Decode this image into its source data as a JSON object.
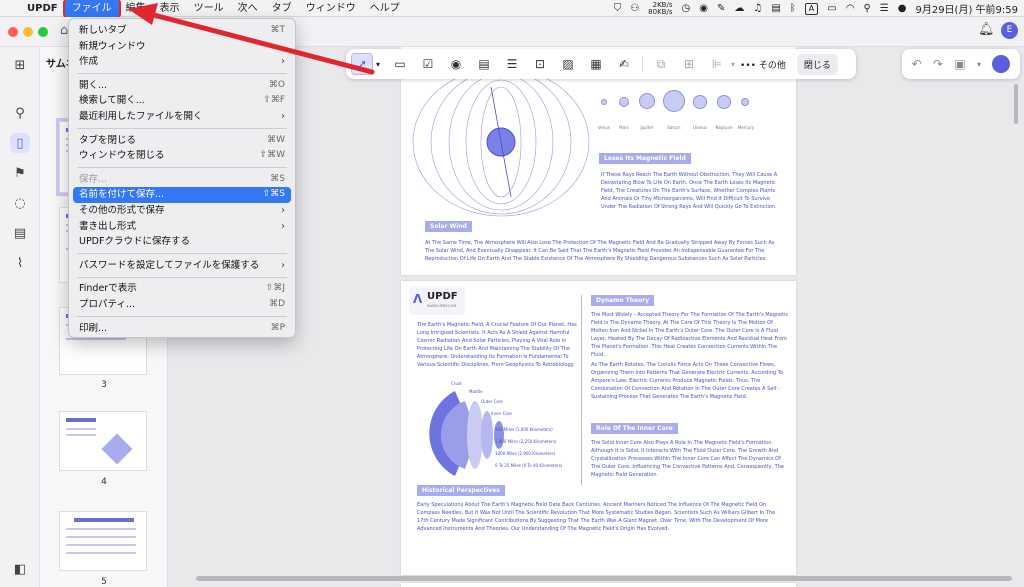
{
  "menubar": {
    "apple": "",
    "app": "UPDF",
    "items": [
      "ファイル",
      "編集",
      "表示",
      "ツール",
      "次へ",
      "タブ",
      "ウィンドウ",
      "ヘルプ"
    ],
    "net_up": "2KB/s",
    "net_down": "80KB/s",
    "input_mode": "A",
    "datetime": "9月29日(月) 午前9:59"
  },
  "thumbs": {
    "header": "サムネ",
    "pages": [
      "3",
      "4",
      "5"
    ]
  },
  "file_menu": {
    "items": [
      {
        "label": "新しいタブ",
        "shortcut": "⌘T"
      },
      {
        "label": "新規ウィンドウ",
        "shortcut": ""
      },
      {
        "label": "作成",
        "submenu": "›"
      },
      {
        "label": "開く...",
        "shortcut": "⌘O"
      },
      {
        "label": "検索して開く...",
        "shortcut": "⇧⌘F"
      },
      {
        "label": "最近利用したファイルを開く",
        "submenu": "›"
      },
      {
        "label": "タブを閉じる",
        "shortcut": "⌘W"
      },
      {
        "label": "ウィンドウを閉じる",
        "shortcut": "⇧⌘W"
      },
      {
        "label": "保存...",
        "shortcut": "⌘S"
      },
      {
        "label": "名前を付けて保存...",
        "shortcut": "⇧⌘S"
      },
      {
        "label": "その他の形式で保存",
        "submenu": "›"
      },
      {
        "label": "書き出し形式",
        "submenu": "›"
      },
      {
        "label": "UPDFクラウドに保存する",
        "shortcut": ""
      },
      {
        "label": "パスワードを設定してファイルを保護する",
        "submenu": "›"
      },
      {
        "label": "Finderで表示",
        "shortcut": "⇧⌘J"
      },
      {
        "label": "プロパティ...",
        "shortcut": "⌘D"
      },
      {
        "label": "印刷...",
        "shortcut": "⌘P"
      }
    ]
  },
  "toolbar": {
    "more_label": "その他",
    "close_label": "閉じる"
  },
  "document": {
    "page1": {
      "section_title_1": "Loses Its Magnetic Field",
      "section_text_1": "If These Rays Reach The Earth Without Obstruction, They Will Cause A Devastating Blow To Life On Earth. Once The Earth Loses Its Magnetic Field, The Creatures On The Earth's Surface, Whether Complex Plants And Animals Or Tiny Microorganisms, Will Find It Difficult To Survive Under The Radiation Of Strong Rays And Will Quickly Go To Extinction.",
      "section_title_2": "Solar Wind",
      "section_text_2": "At The Same Time, The Atmosphere Will Also Lose The Protection Of The Magnetic Field And Be Gradually Stripped Away By Forces Such As The Solar Wind, And Eventually Disappear. It Can Be Said That The Earth's Magnetic Field Provides An Indispensable Guarantee For The Reproduction Of Life On Earth And The Stable Existence Of The Atmosphere By Shielding Dangerous Substances Such As Solar Particles.",
      "planet_labels": [
        "Venus",
        "Mars",
        "Jupiter",
        "Saturn",
        "Uranus",
        "Neptune",
        "Mercury"
      ]
    },
    "page2": {
      "logo_text": "UPDF",
      "logo_sub": "WWW.UPDF.COM",
      "intro_text": "The Earth's Magnetic Field, A Crucial Feature Of Our Planet, Has Long Intrigued Scientists. It Acts As A Shield Against Harmful Cosmic Radiation And Solar Particles, Playing A Vital Role In Protecting Life On Earth And Maintaining The Stability Of The Atmosphere. Understanding Its Formation Is Fundamental To Various Scientific Disciplines, From Geophysics To Astrobiology.",
      "dynamo_title": "Dynamo Theory",
      "dynamo_text": "The Most Widely - Accepted Theory For The Formation Of The Earth's Magnetic Field Is The Dynamo Theory. At The Core Of This Theory Is The Motion Of Molten Iron And Nickel In The Earth's Outer Core. The Outer Core Is A Fluid Layer, Heated By The Decay Of Radioactive Elements And Residual Heat From The Planet's Formation. This Heat Creates Convection Currents Within The Fluid.",
      "dynamo_text_2": "As The Earth Rotates, The Coriolis Force Acts On These Convective Flows, Organizing Them Into Patterns That Generate Electric Currents. According To Ampere's Law, Electric Currents Produce Magnetic Fields. Thus, The Combination Of Convection And Rotation In The Outer Core Creates A Self - Sustaining Process That Generates The Earth's Magnetic Field.",
      "inner_title": "Role Of The Inner Core",
      "inner_text": "The Solid Inner Core Also Plays A Role In The Magnetic Field's Formation. Although It Is Solid, It Interacts With The Fluid Outer Core. The Growth And Crystallization Processes Within The Inner Core Can Affect The Dynamics Of The Outer Core, Influencing The Convective Patterns And, Consequently, The Magnetic Field Generation.",
      "hist_title": "Historical Perspectives",
      "hist_text": "Early Speculations About The Earth's Magnetic Field Date Back Centuries. Ancient Mariners Noticed The Influence Of The Magnetic Field On Compass Needles, But It Was Not Until The Scientific Revolution That More Systematic Studies Began. Scientists Such As William Gilbert In The 17th Century Made Significant Contributions By Suggesting That The Earth Was A Giant Magnet. Over Time, With The Development Of More Advanced Instruments And Theories, Our Understanding Of The Magnetic Field's Origin Has Evolved.",
      "layer_labels": [
        "Crust",
        "Mantle",
        "Outer Core",
        "Inner Core"
      ],
      "depth_labels": [
        "500 Miles (1,000 Kilometers)",
        "1,800 Miles (2,250 Kilometers)",
        "1800 Miles (2,900 Kilometers)",
        "0 To 25 Miles (0 To 40 Kilometers)"
      ]
    }
  },
  "colors": {
    "accent": "#3478f6",
    "doc_purple": "#4a4fc8",
    "label_purple": "#a8abee",
    "arrow_red": "#e0262e"
  }
}
